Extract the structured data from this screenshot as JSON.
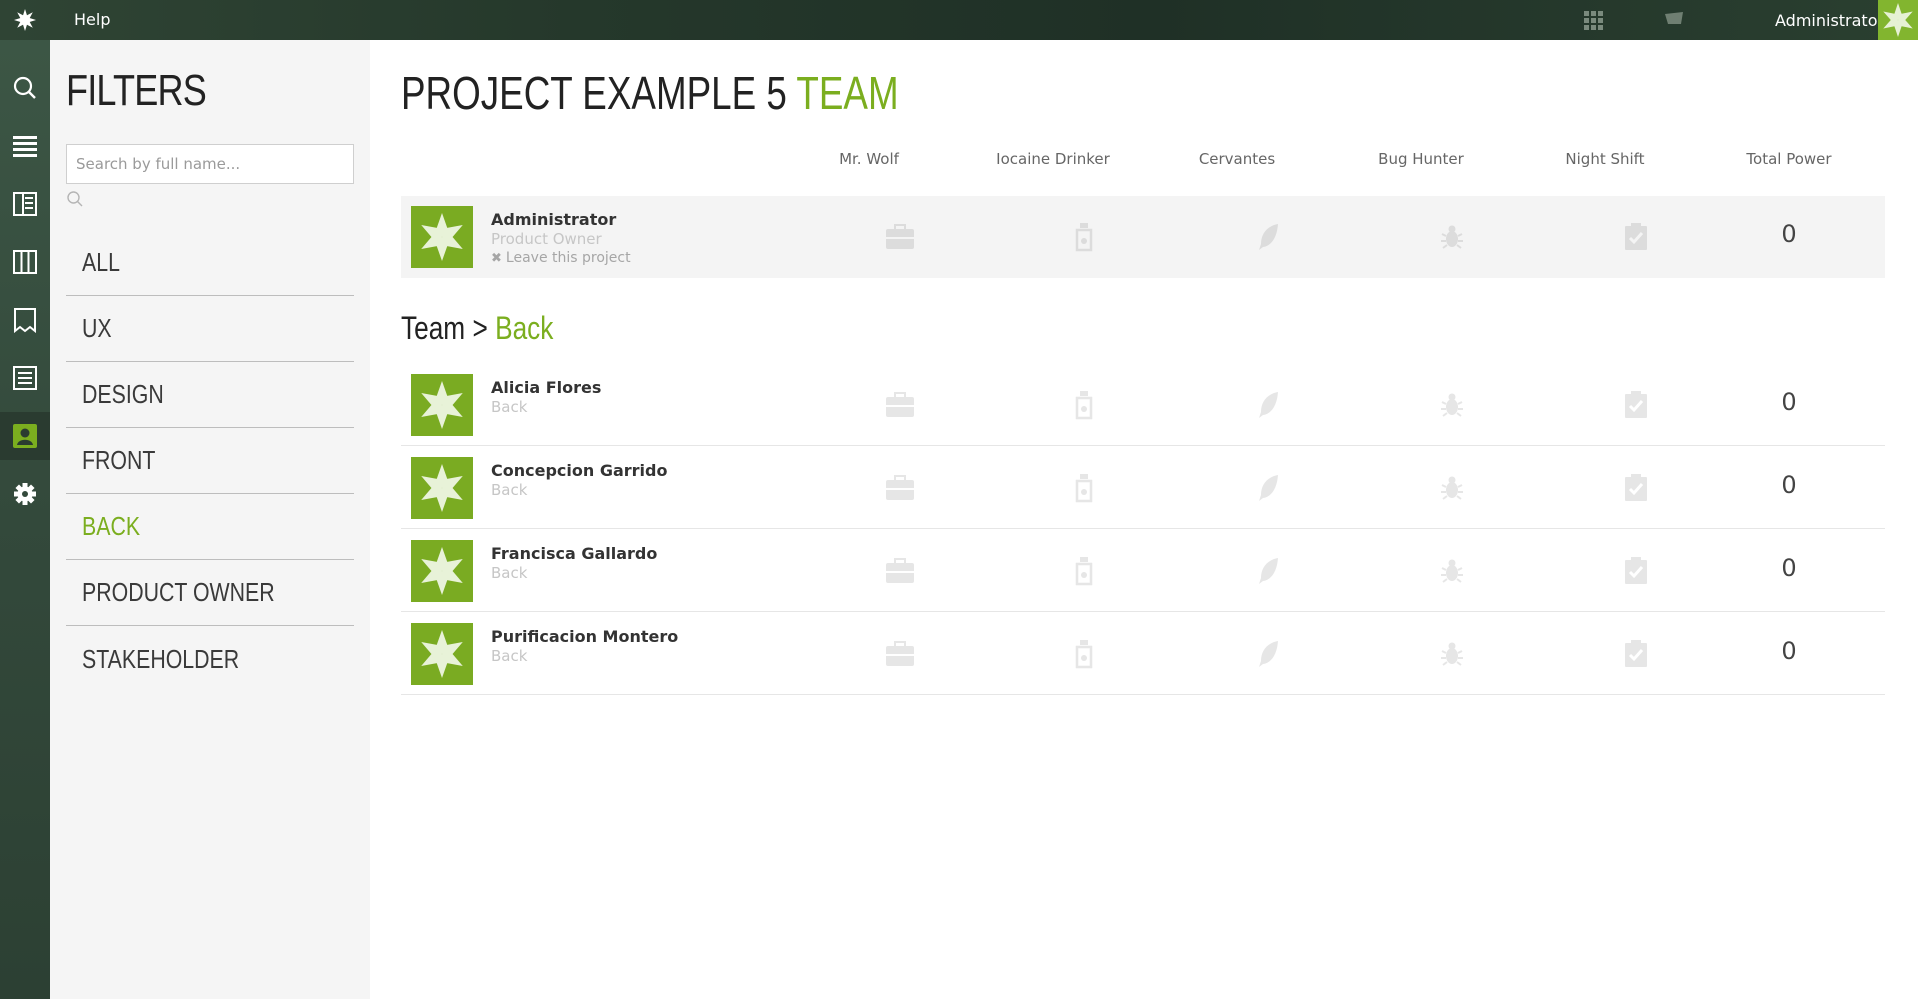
{
  "topbar": {
    "help_label": "Help",
    "user_name": "Administrator",
    "icons": [
      "app-logo-icon",
      "apps-grid-icon",
      "cart-icon",
      "user-avatar"
    ]
  },
  "leftnav": {
    "items": [
      {
        "name": "search-icon"
      },
      {
        "name": "backlog-icon"
      },
      {
        "name": "kanban-icon"
      },
      {
        "name": "board-icon"
      },
      {
        "name": "issues-icon"
      },
      {
        "name": "wiki-icon"
      },
      {
        "name": "team-icon",
        "active": true
      },
      {
        "name": "settings-icon"
      }
    ],
    "active_color": "#7bae1f"
  },
  "filters": {
    "title": "FILTERS",
    "search_placeholder": "Search by full name...",
    "items": [
      {
        "label": "ALL",
        "active": false
      },
      {
        "label": "UX",
        "active": false
      },
      {
        "label": "DESIGN",
        "active": false
      },
      {
        "label": "FRONT",
        "active": false
      },
      {
        "label": "BACK",
        "active": true
      },
      {
        "label": "PRODUCT OWNER",
        "active": false
      },
      {
        "label": "STAKEHOLDER",
        "active": false
      }
    ]
  },
  "main": {
    "title_prefix": "PROJECT EXAMPLE 5",
    "title_accent": "TEAM",
    "columns": [
      "Mr. Wolf",
      "Iocaine Drinker",
      "Cervantes",
      "Bug Hunter",
      "Night Shift",
      "Total Power"
    ],
    "current_user": {
      "name": "Administrator",
      "role": "Product Owner",
      "leave_label": "Leave this project",
      "total": "0"
    },
    "group": {
      "prefix": "Team >",
      "accent": "Back"
    },
    "members": [
      {
        "name": "Alicia Flores",
        "role": "Back",
        "total": "0"
      },
      {
        "name": "Concepcion Garrido",
        "role": "Back",
        "total": "0"
      },
      {
        "name": "Francisca Gallardo",
        "role": "Back",
        "total": "0"
      },
      {
        "name": "Purificacion Montero",
        "role": "Back",
        "total": "0"
      }
    ],
    "power_icons": [
      "briefcase-icon",
      "bottle-icon",
      "feather-icon",
      "bug-icon",
      "clipboard-check-icon"
    ]
  },
  "colors": {
    "accent": "#7bae1f",
    "avatar_bg": "#7aab22",
    "topbar": "#263a2c"
  }
}
